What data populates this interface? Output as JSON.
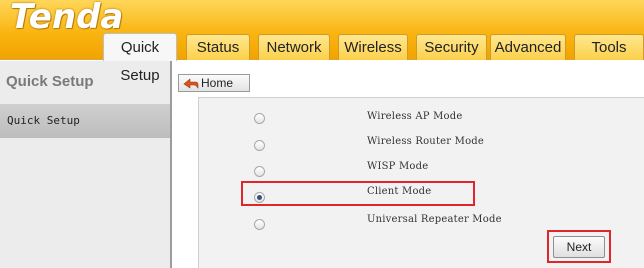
{
  "brand": {
    "logo_text": "Tenda"
  },
  "nav": {
    "tabs": [
      {
        "label": "Quick Setup",
        "active": true
      },
      {
        "label": "Status"
      },
      {
        "label": "Network"
      },
      {
        "label": "Wireless"
      },
      {
        "label": "Security"
      },
      {
        "label": "Advanced"
      },
      {
        "label": "Tools"
      }
    ]
  },
  "sidebar": {
    "title": "Quick Setup",
    "items": [
      {
        "label": "Quick Setup",
        "selected": true
      }
    ]
  },
  "toolbar": {
    "home_label": "Home"
  },
  "modes": [
    {
      "label": "Wireless AP Mode",
      "selected": false
    },
    {
      "label": "Wireless Router Mode",
      "selected": false
    },
    {
      "label": "WISP Mode",
      "selected": false
    },
    {
      "label": "Client Mode",
      "selected": true
    },
    {
      "label": "Universal Repeater Mode",
      "selected": false
    }
  ],
  "actions": {
    "next_label": "Next"
  },
  "colors": {
    "header_accent": "#f9b512",
    "highlight_red": "#e0262b"
  }
}
